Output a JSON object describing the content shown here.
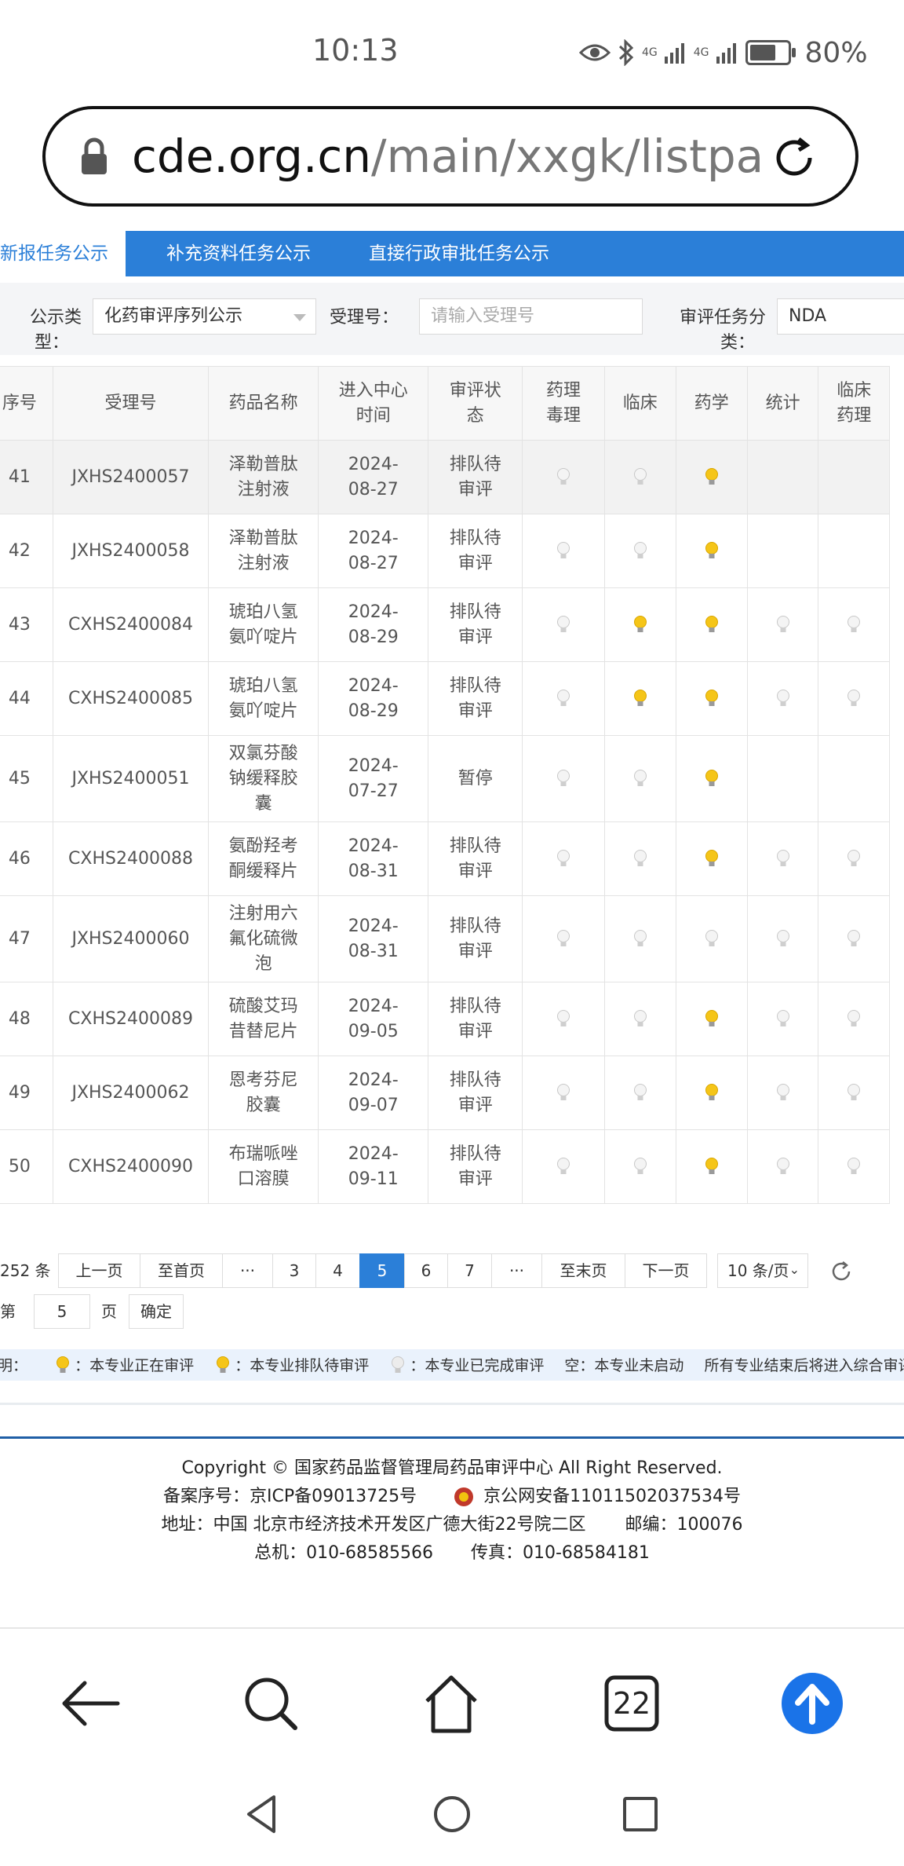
{
  "status_bar": {
    "time": "10:13",
    "network_1": "4G",
    "network_2": "4G",
    "battery": "80%",
    "battery_level": 0.8
  },
  "browser": {
    "url_host": "cde.org.cn",
    "url_path": "/main/xxgk/listpa",
    "tab_count": "22"
  },
  "tabs": [
    {
      "label": "新报任务公示",
      "active": true
    },
    {
      "label": "补充资料任务公示",
      "active": false
    },
    {
      "label": "直接行政审批任务公示",
      "active": false
    }
  ],
  "filters": {
    "type_label_1": "公示类",
    "type_label_2": "型：",
    "type_value": "化药审评序列公示",
    "accept_label": "受理号：",
    "accept_placeholder": "请输入受理号",
    "task_label_1": "审评任务分",
    "task_label_2": "类：",
    "task_value": "NDA"
  },
  "table": {
    "headers": [
      [
        "序号"
      ],
      [
        "受理号"
      ],
      [
        "药品名称"
      ],
      [
        "进入中心",
        "时间"
      ],
      [
        "审评状",
        "态"
      ],
      [
        "药理",
        "毒理"
      ],
      [
        "临床"
      ],
      [
        "药学"
      ],
      [
        "统计"
      ],
      [
        "临床",
        "药理"
      ]
    ],
    "rows": [
      {
        "no": "41",
        "id": "JXHS2400057",
        "name": [
          "泽勒普肽",
          "注射液"
        ],
        "date": [
          "2024-",
          "08-27"
        ],
        "status": [
          "排队待",
          "审评"
        ],
        "bulbs": [
          "done",
          "done",
          "queued",
          "",
          ""
        ]
      },
      {
        "no": "42",
        "id": "JXHS2400058",
        "name": [
          "泽勒普肽",
          "注射液"
        ],
        "date": [
          "2024-",
          "08-27"
        ],
        "status": [
          "排队待",
          "审评"
        ],
        "bulbs": [
          "done",
          "done",
          "queued",
          "",
          ""
        ]
      },
      {
        "no": "43",
        "id": "CXHS2400084",
        "name": [
          "琥珀八氢",
          "氨吖啶片"
        ],
        "date": [
          "2024-",
          "08-29"
        ],
        "status": [
          "排队待",
          "审评"
        ],
        "bulbs": [
          "done",
          "queued",
          "queued",
          "done",
          "done"
        ]
      },
      {
        "no": "44",
        "id": "CXHS2400085",
        "name": [
          "琥珀八氢",
          "氨吖啶片"
        ],
        "date": [
          "2024-",
          "08-29"
        ],
        "status": [
          "排队待",
          "审评"
        ],
        "bulbs": [
          "done",
          "queued",
          "queued",
          "done",
          "done"
        ]
      },
      {
        "no": "45",
        "id": "JXHS2400051",
        "name": [
          "双氯芬酸",
          "钠缓释胶",
          "囊"
        ],
        "date": [
          "2024-",
          "07-27"
        ],
        "status": [
          "暂停"
        ],
        "bulbs": [
          "done",
          "done",
          "queued",
          "",
          ""
        ]
      },
      {
        "no": "46",
        "id": "CXHS2400088",
        "name": [
          "氨酚羟考",
          "酮缓释片"
        ],
        "date": [
          "2024-",
          "08-31"
        ],
        "status": [
          "排队待",
          "审评"
        ],
        "bulbs": [
          "done",
          "done",
          "queued",
          "done",
          "done"
        ]
      },
      {
        "no": "47",
        "id": "JXHS2400060",
        "name": [
          "注射用六",
          "氟化硫微",
          "泡"
        ],
        "date": [
          "2024-",
          "08-31"
        ],
        "status": [
          "排队待",
          "审评"
        ],
        "bulbs": [
          "done",
          "done",
          "done",
          "done",
          "done"
        ]
      },
      {
        "no": "48",
        "id": "CXHS2400089",
        "name": [
          "硫酸艾玛",
          "昔替尼片"
        ],
        "date": [
          "2024-",
          "09-05"
        ],
        "status": [
          "排队待",
          "审评"
        ],
        "bulbs": [
          "done",
          "done",
          "queued",
          "done",
          "done"
        ]
      },
      {
        "no": "49",
        "id": "JXHS2400062",
        "name": [
          "恩考芬尼",
          "胶囊"
        ],
        "date": [
          "2024-",
          "09-07"
        ],
        "status": [
          "排队待",
          "审评"
        ],
        "bulbs": [
          "done",
          "done",
          "queued",
          "done",
          "done"
        ]
      },
      {
        "no": "50",
        "id": "CXHS2400090",
        "name": [
          "布瑞哌唑",
          "口溶膜"
        ],
        "date": [
          "2024-",
          "09-11"
        ],
        "status": [
          "排队待",
          "审评"
        ],
        "bulbs": [
          "done",
          "done",
          "queued",
          "done",
          "done"
        ]
      }
    ]
  },
  "pagination": {
    "total": "252 条",
    "prev": "上一页",
    "first": "至首页",
    "ellipsis": "···",
    "pages": [
      "3",
      "4",
      "5",
      "6",
      "7"
    ],
    "current": "5",
    "last": "至末页",
    "next": "下一页",
    "page_size": "10 条/页",
    "goto_prefix": "到第",
    "goto_value": "5",
    "goto_suffix": "页",
    "confirm": "确定"
  },
  "legend": {
    "prefix": "说明：",
    "active": "：本专业正在审评",
    "queued": "：本专业排队待审评",
    "done": "：本专业已完成审评",
    "empty": "空：本专业未启动",
    "note": "所有专业结束后将进入综合审评"
  },
  "footer": {
    "copyright": "Copyright © 国家药品监督管理局药品审评中心   All Right Reserved.",
    "icp": "备案序号：京ICP备09013725号",
    "police": "京公网安备11011502037534号",
    "address": "地址：中国 北京市经济技术开发区广德大街22号院二区",
    "postcode": "邮编：100076",
    "phone": "总机：010-68585566",
    "fax": "传真：010-68584181"
  },
  "colors": {
    "accent": "#2b7fd8",
    "bulb_active": "#f5c518",
    "bulb_done": "#e2e2e2"
  }
}
